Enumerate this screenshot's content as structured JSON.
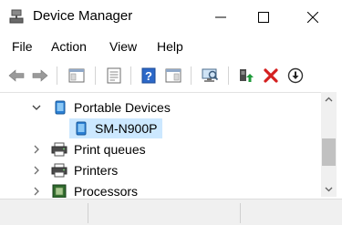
{
  "window": {
    "title": "Device Manager",
    "icons": {
      "app": "device-manager-icon",
      "minimize": "minimize-icon",
      "maximize": "maximize-icon",
      "close": "close-icon"
    }
  },
  "menu": {
    "items": [
      {
        "label": "File"
      },
      {
        "label": "Action"
      },
      {
        "label": "View"
      },
      {
        "label": "Help"
      }
    ]
  },
  "toolbar": {
    "buttons": [
      {
        "icon": "back-arrow-icon"
      },
      {
        "icon": "forward-arrow-icon"
      },
      {
        "icon": "show-hide-console-tree-icon"
      },
      {
        "icon": "properties-icon"
      },
      {
        "icon": "help-icon"
      },
      {
        "icon": "action-pane-icon"
      },
      {
        "icon": "scan-hardware-icon"
      },
      {
        "icon": "update-driver-icon"
      },
      {
        "icon": "uninstall-device-icon"
      },
      {
        "icon": "disable-device-icon"
      }
    ]
  },
  "tree": {
    "nodes": [
      {
        "label": "Portable Devices",
        "expanded": true,
        "icon": "portable-device-icon"
      },
      {
        "label": "SM-N900P",
        "selected": true,
        "icon": "phone-device-icon"
      },
      {
        "label": "Print queues",
        "expanded": false,
        "icon": "printer-icon"
      },
      {
        "label": "Printers",
        "expanded": false,
        "icon": "printer-icon"
      },
      {
        "label": "Processors",
        "expanded": false,
        "icon": "processor-icon"
      }
    ]
  },
  "scrollbar": {
    "up_icon": "scroll-up-icon",
    "down_icon": "scroll-down-icon"
  },
  "colors": {
    "selection": "#cce8ff",
    "close_red": "#d41f1f",
    "help_blue": "#2c68c8",
    "update_green": "#1e9a3a"
  }
}
